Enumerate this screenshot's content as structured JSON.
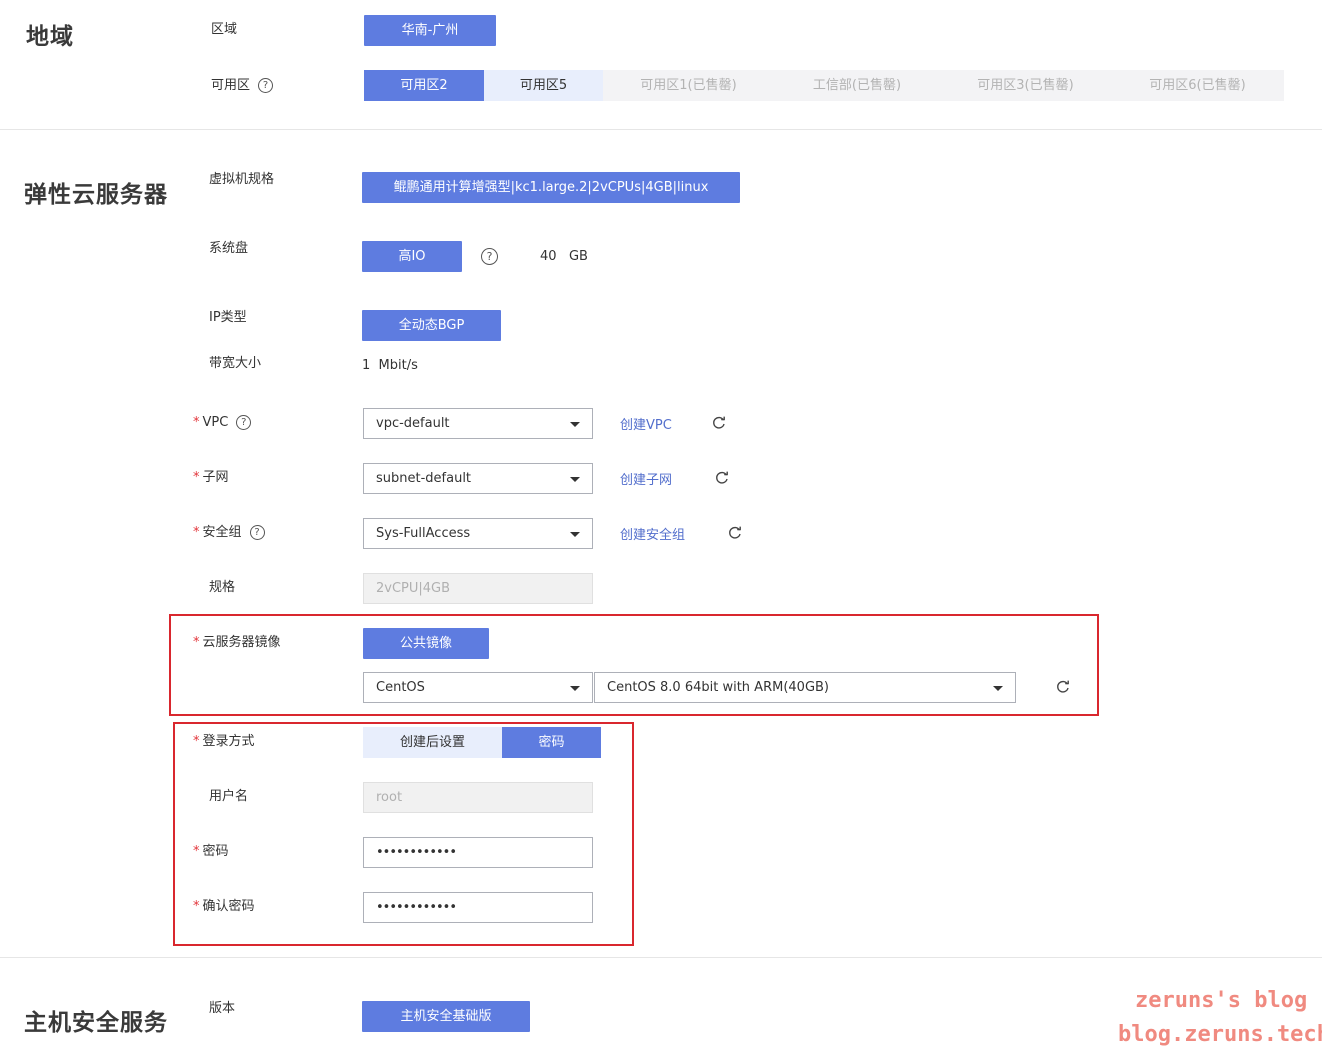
{
  "region_section": {
    "title": "地域",
    "region_label": "区域",
    "region_value": "华南-广州",
    "az_label": "可用区",
    "az_tabs": [
      "可用区2",
      "可用区5",
      "可用区1(已售罄)",
      "工信部(已售罄)",
      "可用区3(已售罄)",
      "可用区6(已售罄)"
    ]
  },
  "ecs_section": {
    "title": "弹性云服务器",
    "flavor_label": "虚拟机规格",
    "flavor_value": "鲲鹏通用计算增强型|kc1.large.2|2vCPUs|4GB|linux",
    "disk_label": "系统盘",
    "disk_type": "高IO",
    "disk_size": "40",
    "disk_unit": "GB",
    "ip_label": "IP类型",
    "ip_value": "全动态BGP",
    "bandwidth_label": "带宽大小",
    "bandwidth_value": "1",
    "bandwidth_unit": "Mbit/s",
    "vpc_label": "VPC",
    "vpc_value": "vpc-default",
    "vpc_link": "创建VPC",
    "subnet_label": "子网",
    "subnet_value": "subnet-default",
    "subnet_link": "创建子网",
    "sg_label": "安全组",
    "sg_value": "Sys-FullAccess",
    "sg_link": "创建安全组",
    "spec_label": "规格",
    "spec_value": "2vCPU|4GB",
    "image_label": "云服务器镜像",
    "image_type": "公共镜像",
    "os_value": "CentOS",
    "os_version_value": "CentOS 8.0 64bit with ARM(40GB)",
    "login_label": "登录方式",
    "login_options": [
      "创建后设置",
      "密码"
    ],
    "username_label": "用户名",
    "username_value": "root",
    "password_label": "密码",
    "password_value": "••••••••••••",
    "confirm_label": "确认密码",
    "confirm_value": "••••••••••••"
  },
  "hss_section": {
    "title": "主机安全服务",
    "version_label": "版本",
    "version_value": "主机安全基础版"
  },
  "watermark": {
    "line1": "zeruns's blog",
    "line2": "blog.zeruns.tech"
  },
  "colors": {
    "primary": "#5e7ce0",
    "link": "#526ecc",
    "required": "#e2343a",
    "highlight_box": "#d9272e"
  }
}
